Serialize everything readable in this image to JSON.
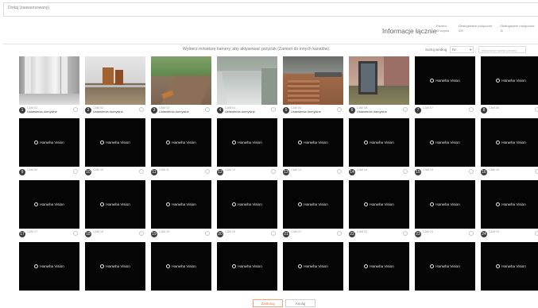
{
  "window": {
    "title": "Dodaj (zaawansowany)"
  },
  "info": {
    "title": "Informacje łącznie",
    "headers": [
      "Razem",
      "Obsługiwane połączone",
      "Obsługiwane rozłączone"
    ],
    "values": [
      "W użyciu",
      "0/8",
      "11"
    ]
  },
  "instruction": "Wybierz miniaturę kamery, aby aktywować przycisk (Zamień do innych kanałów).",
  "sort": {
    "label": "Sortuj według",
    "selected": "Nr.",
    "search_placeholder": "Wyszukaj nazwę kamery"
  },
  "logo_text": "Hanwha Vision",
  "cameras": [
    {
      "badge": "1",
      "name": "CAM 01",
      "status": "Ustawienia domyślne"
    },
    {
      "badge": "2",
      "name": "CAM 02",
      "status": "Ustawienia domyślne"
    },
    {
      "badge": "3",
      "name": "CAM 03",
      "status": "Ustawienia domyślne"
    },
    {
      "badge": "4",
      "name": "CAM 04",
      "status": "Ustawienia domyślne"
    },
    {
      "badge": "5",
      "name": "CAM 05",
      "status": "Ustawienia domyślne"
    },
    {
      "badge": "6",
      "name": "CAM 06",
      "status": "Ustawienia domyślne"
    },
    {
      "badge": "7",
      "name": "CAM 07",
      "status": ""
    },
    {
      "badge": "8",
      "name": "CAM 08",
      "status": ""
    },
    {
      "badge": "9",
      "name": "CAM 09",
      "status": ""
    },
    {
      "badge": "10",
      "name": "CAM 10",
      "status": ""
    },
    {
      "badge": "11",
      "name": "CAM 11",
      "status": ""
    },
    {
      "badge": "12",
      "name": "CAM 12",
      "status": ""
    },
    {
      "badge": "13",
      "name": "CAM 13",
      "status": ""
    },
    {
      "badge": "14",
      "name": "CAM 14",
      "status": ""
    },
    {
      "badge": "15",
      "name": "CAM 15",
      "status": ""
    },
    {
      "badge": "16",
      "name": "CAM 16",
      "status": ""
    },
    {
      "badge": "17",
      "name": "CAM 17",
      "status": ""
    },
    {
      "badge": "18",
      "name": "CAM 18",
      "status": ""
    },
    {
      "badge": "19",
      "name": "CAM 19",
      "status": ""
    },
    {
      "badge": "20",
      "name": "CAM 20",
      "status": ""
    },
    {
      "badge": "21",
      "name": "CAM 21",
      "status": ""
    },
    {
      "badge": "22",
      "name": "CAM 22",
      "status": ""
    },
    {
      "badge": "23",
      "name": "CAM 23",
      "status": ""
    },
    {
      "badge": "24",
      "name": "CAM 24",
      "status": ""
    },
    {
      "badge": "",
      "name": "",
      "status": ""
    },
    {
      "badge": "",
      "name": "",
      "status": ""
    },
    {
      "badge": "",
      "name": "",
      "status": ""
    },
    {
      "badge": "",
      "name": "",
      "status": ""
    },
    {
      "badge": "",
      "name": "",
      "status": ""
    },
    {
      "badge": "",
      "name": "",
      "status": ""
    },
    {
      "badge": "",
      "name": "",
      "status": ""
    },
    {
      "badge": "",
      "name": "",
      "status": ""
    }
  ],
  "footer": {
    "apply_label": "Zastosuj",
    "cancel_label": "Anuluj"
  },
  "colors": {
    "accent": "#e5753f",
    "thumb_bg": "#050505"
  }
}
